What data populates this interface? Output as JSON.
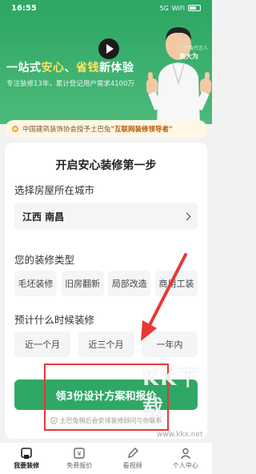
{
  "status_bar": {
    "time": "16:55",
    "signal": "5G",
    "wifi": "WiFi"
  },
  "hero": {
    "title_part1": "一站式",
    "title_hl1": "安心",
    "title_part2": "、",
    "title_hl2": "省钱",
    "title_part3": "新体验",
    "subtitle": "专注装修13年，累计登记用户需求4100万",
    "spokesperson_label": "土巴兔代言人",
    "spokesperson_name": "袁大为"
  },
  "cert_strip": {
    "text": "中国建筑装饰协会授予土巴兔",
    "highlight": "\"互联网装修领导者\""
  },
  "form": {
    "title": "开启安心装修第一步",
    "city_label": "选择房屋所在城市",
    "city_value": "江西 南昌",
    "type_label": "您的装修类型",
    "type_options": [
      "毛坯装修",
      "旧房翻新",
      "局部改造",
      "商用工装"
    ],
    "time_label": "预计什么时候装修",
    "time_options": [
      "近一个月",
      "近三个月",
      "一年内"
    ],
    "cta_label": "领3份设计方案和报价",
    "privacy_note": "土巴兔稍后会安排装修顾问与你联系"
  },
  "bottom_nav": {
    "items": [
      "我要装修",
      "免费报价",
      "看视频",
      "个人中心"
    ],
    "active_index": 0
  },
  "watermark": {
    "text": "KK下载",
    "url": "www.kkx.net"
  },
  "colors": {
    "brand_green": "#2fa866",
    "annotation_red": "#e53935",
    "highlight_yellow": "#ffe566"
  }
}
